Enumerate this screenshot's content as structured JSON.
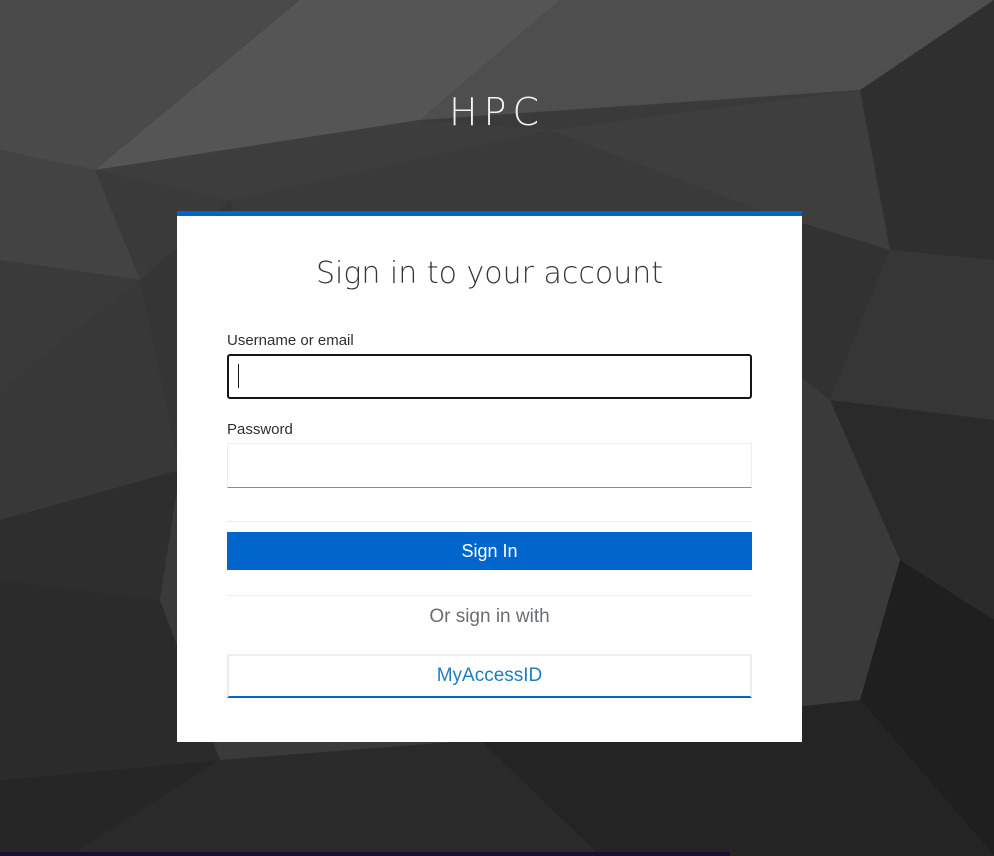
{
  "realm": {
    "title": "HPC"
  },
  "login": {
    "header": "Sign in to your account",
    "username": {
      "label": "Username or email",
      "value": "",
      "placeholder": ""
    },
    "password": {
      "label": "Password",
      "value": "",
      "placeholder": ""
    },
    "submit_label": "Sign In",
    "social_heading": "Or sign in with",
    "providers": [
      {
        "label": "MyAccessID"
      }
    ]
  },
  "colors": {
    "accent": "#0066cc",
    "link": "#1d7fc1",
    "background": "#3a3a3a",
    "card": "#ffffff"
  }
}
